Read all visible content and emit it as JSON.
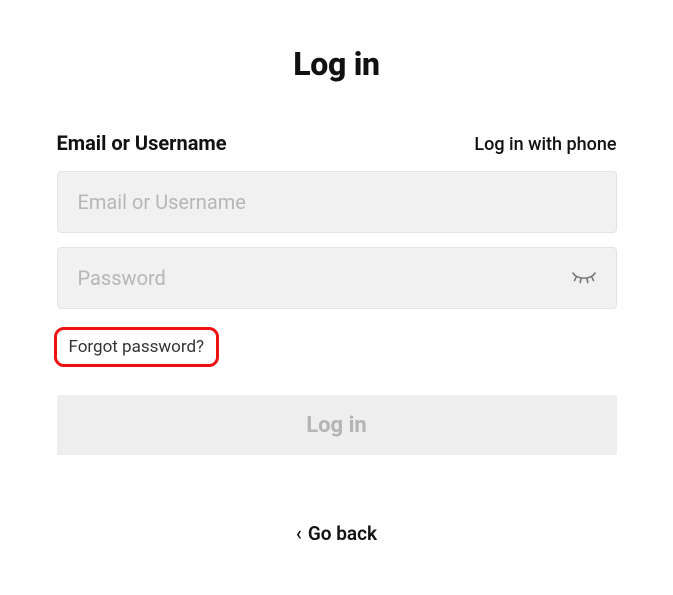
{
  "title": "Log in",
  "header": {
    "label": "Email or Username",
    "phone_link": "Log in with phone"
  },
  "inputs": {
    "username_placeholder": "Email or Username",
    "password_placeholder": "Password"
  },
  "links": {
    "forgot": "Forgot password?"
  },
  "buttons": {
    "login": "Log in"
  },
  "footer": {
    "goback": "Go back"
  },
  "highlight": {
    "target": "forgot-password",
    "color": "#e11"
  }
}
